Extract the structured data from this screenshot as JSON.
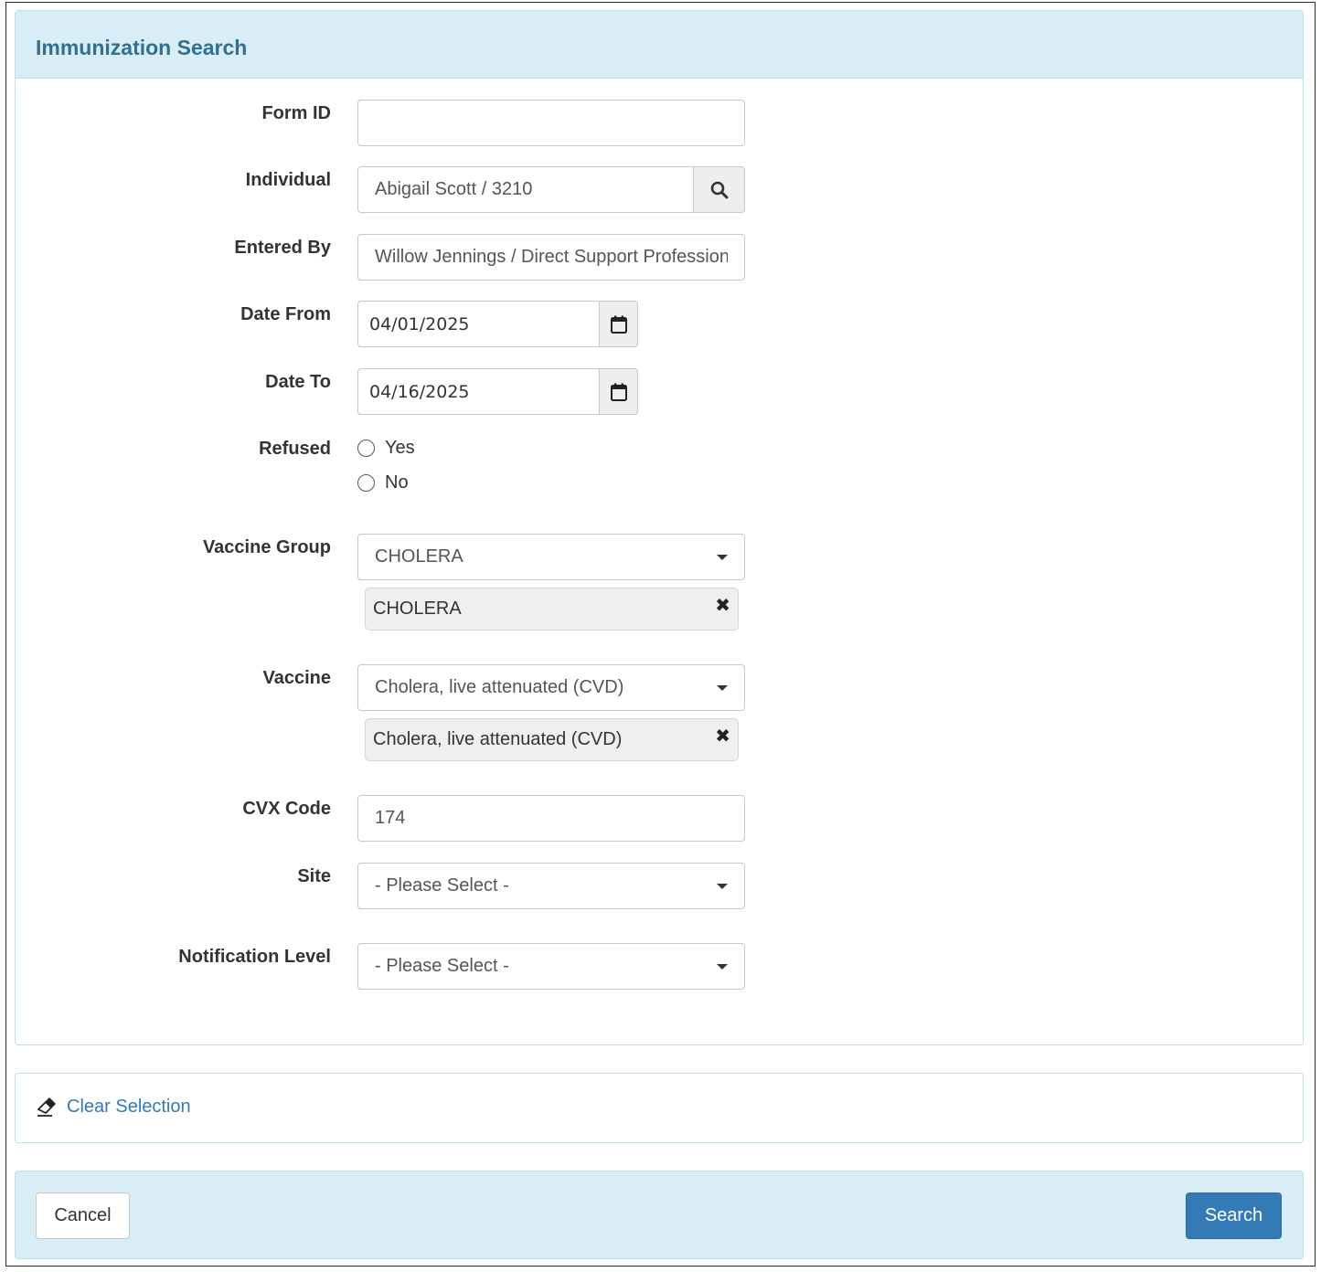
{
  "panel": {
    "title": "Immunization Search"
  },
  "fields": {
    "form_id": {
      "label": "Form ID",
      "value": ""
    },
    "individual": {
      "label": "Individual",
      "value": "Abigail Scott / 3210",
      "icon": "search-icon"
    },
    "entered_by": {
      "label": "Entered By",
      "value": "Willow Jennings / Direct Support Professional"
    },
    "date_from": {
      "label": "Date From",
      "value": "04/01/2025",
      "icon": "calendar-icon"
    },
    "date_to": {
      "label": "Date To",
      "value": "04/16/2025",
      "icon": "calendar-icon"
    },
    "refused": {
      "label": "Refused",
      "options": [
        "Yes",
        "No"
      ]
    },
    "vaccine_group": {
      "label": "Vaccine Group",
      "selected": "CHOLERA",
      "chips": [
        "CHOLERA"
      ]
    },
    "vaccine": {
      "label": "Vaccine",
      "selected": "Cholera, live attenuated (CVD)",
      "chips": [
        "Cholera, live attenuated (CVD)"
      ]
    },
    "cvx_code": {
      "label": "CVX Code",
      "value": "174"
    },
    "site": {
      "label": "Site",
      "selected": "- Please Select -"
    },
    "notification_level": {
      "label": "Notification Level",
      "selected": "- Please Select -"
    }
  },
  "actions": {
    "clear_selection": "Clear Selection",
    "clear_icon": "eraser-icon",
    "cancel": "Cancel",
    "search": "Search"
  },
  "colors": {
    "panel_heading_bg": "#d9edf7",
    "title_color": "#31708f",
    "link_color": "#337ab7",
    "primary_button": "#337ab7"
  }
}
